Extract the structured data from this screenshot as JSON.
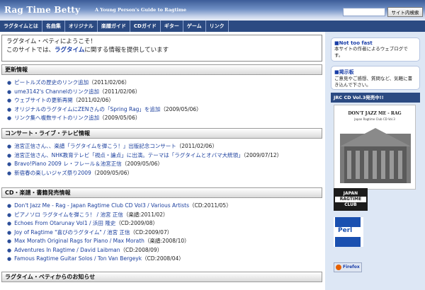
{
  "header": {
    "title": "Rag Time Betty",
    "tagline": "A Young Person's Guide to Ragtime",
    "search_placeholder": "",
    "search_button": "サイト内検索"
  },
  "nav": [
    "ラグタイムとは",
    "名曲集",
    "オリジナル",
    "楽譜ガイド",
    "CDガイド",
    "ギター",
    "ゲーム",
    "リンク"
  ],
  "welcome": {
    "line1": "ラグタイム・ベティにようこそ！",
    "line2_pre": "このサイトでは、",
    "line2_hl": "ラグタイム",
    "line2_post": "に関する情報を提供しています"
  },
  "sections": [
    {
      "title": "更新情報",
      "items": [
        {
          "text": "ピートルズの歴史のリンク追加",
          "suffix": "（2011/02/06）"
        },
        {
          "text": "ume3142's Channelのリンク追加",
          "suffix": "（2011/02/06）"
        },
        {
          "text": "ウェブサイトの更新再開",
          "suffix": "（2011/02/06）"
        },
        {
          "text": "オリジナルのラグタイムにZENさんの「Spring Rag」を追加",
          "suffix": "（2009/05/06）"
        },
        {
          "text": "リンク集へ複数サイトのリンク追加",
          "suffix": "（2009/05/06）"
        }
      ]
    },
    {
      "title": "コンサート・ライブ・テレビ情報",
      "items": [
        {
          "text": "池宮正信さん、、楽譜「ラグタイムを弾こう！」出版記念コンサート",
          "suffix": "（2011/02/06）"
        },
        {
          "text": "池宮正信さん、NHK教育テレビ「視点・論点」に出演。テーマは「ラグタイムとオバマ大統領」",
          "suffix": "（2009/07/12）"
        },
        {
          "text": "Bravo!Piano 2009 レ・フレール＆池宮正信",
          "suffix": "（2009/05/06）"
        },
        {
          "text": "新宿春の楽しいジャズ祭り2009",
          "suffix": "（2009/05/06）"
        }
      ]
    },
    {
      "title": "CD・楽譜・書籍発売情報",
      "items": [
        {
          "text": "Don't Jazz Me - Rag - Japan Ragtime Club CD Vol3 / Various Artists",
          "suffix": "（CD:2011/05）"
        },
        {
          "text": "ピアノソロ ラグタイムを弾こう！ / 池宮 正信",
          "suffix": "（楽譜:2011/02）"
        },
        {
          "text": "Echoes From Otarunay Vol1 / 浜田 隆史",
          "suffix": "（CD:2009/08）"
        },
        {
          "text": "Joy of Ragtime \"喜びのラグタイム\" / 池宮 正信",
          "suffix": "（CD:2009/07）"
        },
        {
          "text": "Max Morath Original Rags for Piano / Max Morath",
          "suffix": "（楽譜:2008/10）"
        },
        {
          "text": "Adventures In Ragtime / David Laibman",
          "suffix": "（CD:2008/09）"
        },
        {
          "text": "Famous Ragtime Guitar Solos / Ton Van Bergeyk",
          "suffix": "（CD:2008/04）"
        }
      ]
    },
    {
      "title": "ラグタイム・ベティからのお知らせ",
      "items": []
    }
  ],
  "sidebar": {
    "notice1_title": "■Not too fast",
    "notice1_body": "本サイトの作者によるウェブログです。",
    "notice2_title": "■掲示板",
    "notice2_body": "ご意見やご感想、質問など、気軽に書き込んで下さい。",
    "jrc_heading": "JRC CD Vol.3発売中!!",
    "cd_title": "DON'T JAZZ ME - RAG",
    "cd_subtitle": "Japan Ragtime Club CD Vol.3",
    "jrc_logo_top": "JAPAN",
    "jrc_logo_mid": "RAGTIME",
    "jrc_logo_bottom": "CLUB",
    "perl_label": "Perl",
    "firefox_label": "Firefox"
  },
  "colors": {
    "nav_bg": "#2b4a82",
    "link": "#1b3f9e",
    "sidebar_bg": "#dde7f5"
  }
}
